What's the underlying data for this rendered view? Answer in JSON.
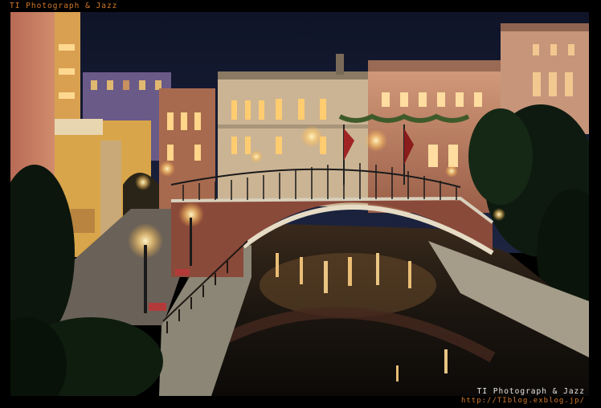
{
  "watermark": {
    "top_label": "TI Photograph & Jazz",
    "bottom_label": "TI Photograph & Jazz",
    "url": "http://TIblog.exblog.jp/"
  },
  "colors": {
    "frame": "#000000",
    "accent_text": "#d2782a",
    "sky": "#14192e",
    "water": "#1a1410",
    "lamp_glow": "#ffd98a",
    "bridge_brick": "#8a4a3a",
    "left_building": "#c98a6a",
    "yellow_building": "#d9a54a"
  },
  "scene": {
    "subject": "venetian-canal-bridge-night",
    "icons": [
      "street-lamp-icon",
      "flag-icon",
      "tree-icon"
    ]
  }
}
